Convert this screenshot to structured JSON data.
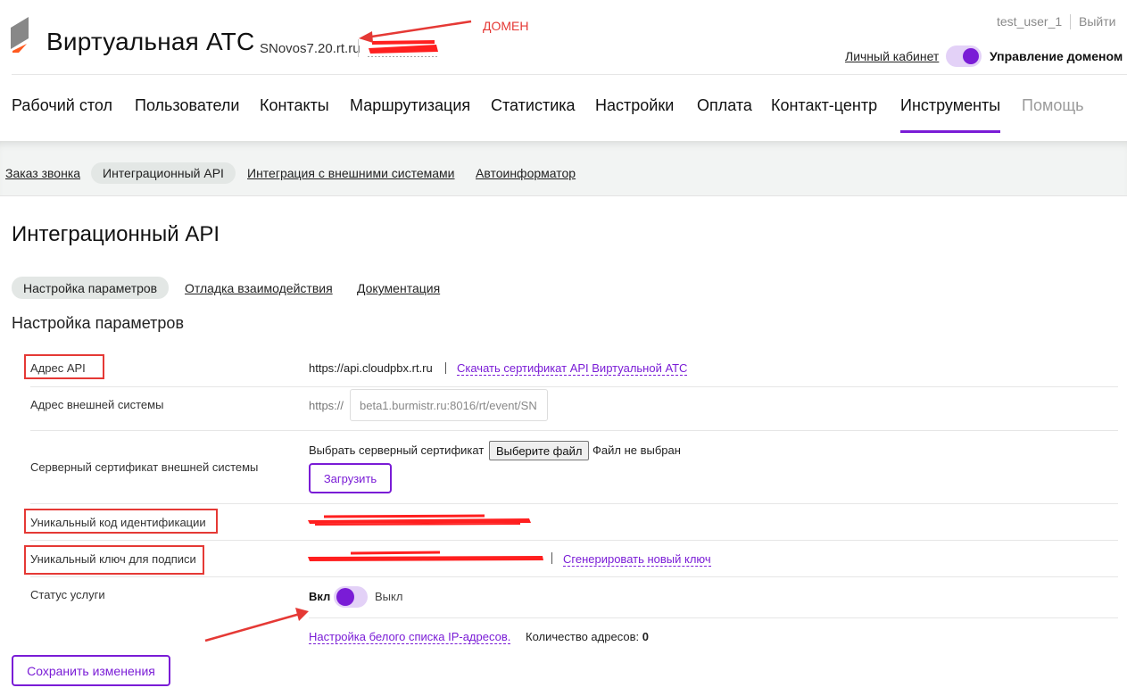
{
  "header": {
    "app_title": "Виртуальная АТС",
    "domain": "SNovos7.20.rt.ru",
    "annotation_domain": "ДОМЕН",
    "user": "test_user_1",
    "logout": "Выйти",
    "cabinet": "Личный кабинет",
    "domain_management": "Управление доменом"
  },
  "main_nav": [
    "Рабочий стол",
    "Пользователи",
    "Контакты",
    "Маршрутизация",
    "Статистика",
    "Настройки",
    "Оплата",
    "Контакт-центр",
    "Инструменты",
    "Помощь"
  ],
  "sub_nav": [
    "Заказ звонка",
    "Интеграционный API",
    "Интеграция с внешними системами",
    "Автоинформатор"
  ],
  "page_title": "Интеграционный API",
  "tabs": [
    "Настройка параметров",
    "Отладка взаимодействия",
    "Документация"
  ],
  "section_title": "Настройка параметров",
  "form": {
    "api_address_label": "Адрес API",
    "api_address": "https://api.cloudpbx.rt.ru",
    "download_cert": "Скачать сертификат API Виртуальной АТС",
    "ext_address_label": "Адрес внешней системы",
    "ext_prefix": "https://",
    "ext_value": "beta1.burmistr.ru:8016/rt/event/SN",
    "server_cert_label": "Серверный сертификат внешней системы",
    "choose_cert": "Выбрать серверный сертификат",
    "choose_file": "Выберите файл",
    "no_file": "Файл не выбран",
    "upload": "Загрузить",
    "uid_label": "Уникальный код идентификации",
    "sign_key_label": "Уникальный ключ для подписи",
    "generate_key": "Сгенерировать новый ключ",
    "status_label": "Статус услуги",
    "status_on": "Вкл",
    "status_off": "Выкл",
    "whitelist": "Настройка белого списка IP-адресов.",
    "address_count_label": "Количество адресов:",
    "address_count": "0",
    "save": "Сохранить изменения"
  },
  "colors": {
    "accent": "#7a1cd6",
    "annotation": "#e53935",
    "toggle_track": "#e3d1f7"
  }
}
